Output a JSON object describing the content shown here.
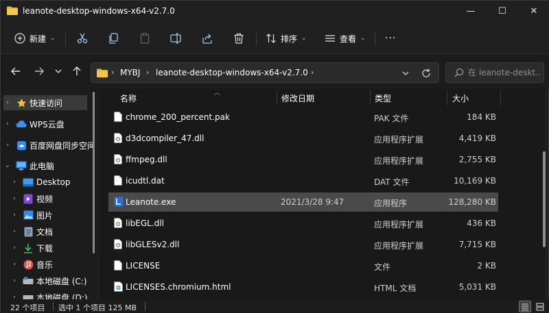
{
  "window": {
    "title": "leanote-desktop-windows-x64-v2.7.0",
    "controls": {
      "minimize": "—",
      "maximize": "☐",
      "close": "✕"
    }
  },
  "toolbar": {
    "new_label": "新建",
    "sort_label": "排序",
    "view_label": "查看",
    "more_label": "···"
  },
  "address": {
    "crumbs": [
      "MYBJ",
      "leanote-desktop-windows-x64-v2.7.0"
    ],
    "search_placeholder": "在 leanote-deskt..."
  },
  "sidebar": {
    "items": [
      {
        "label": "快速访问",
        "icon": "star-icon",
        "selected": true
      },
      {
        "label": "WPS云盘",
        "icon": "cloud-icon"
      },
      {
        "label": "百度网盘同步空间",
        "icon": "baidu-icon"
      },
      {
        "label": "此电脑",
        "icon": "pc-icon",
        "expanded": true
      },
      {
        "label": "Desktop",
        "icon": "desktop-icon"
      },
      {
        "label": "视频",
        "icon": "video-icon"
      },
      {
        "label": "图片",
        "icon": "picture-icon"
      },
      {
        "label": "文档",
        "icon": "document-icon"
      },
      {
        "label": "下载",
        "icon": "download-icon"
      },
      {
        "label": "音乐",
        "icon": "music-icon"
      },
      {
        "label": "本地磁盘 (C:)",
        "icon": "drive-icon"
      },
      {
        "label": "本地磁盘 (D:)",
        "icon": "drive-icon"
      }
    ]
  },
  "columns": {
    "name": "名称",
    "date": "修改日期",
    "type": "类型",
    "size": "大小"
  },
  "files": [
    {
      "name": "chrome_200_percent.pak",
      "date": "",
      "type": "PAK 文件",
      "size": "184 KB",
      "icon": "file-icon"
    },
    {
      "name": "d3dcompiler_47.dll",
      "date": "",
      "type": "应用程序扩展",
      "size": "4,419 KB",
      "icon": "dll-icon"
    },
    {
      "name": "ffmpeg.dll",
      "date": "",
      "type": "应用程序扩展",
      "size": "2,755 KB",
      "icon": "dll-icon"
    },
    {
      "name": "icudtl.dat",
      "date": "",
      "type": "DAT 文件",
      "size": "10,169 KB",
      "icon": "file-icon"
    },
    {
      "name": "Leanote.exe",
      "date": "2021/3/28 9:47",
      "type": "应用程序",
      "size": "128,280 KB",
      "icon": "exe-icon",
      "selected": true
    },
    {
      "name": "libEGL.dll",
      "date": "",
      "type": "应用程序扩展",
      "size": "436 KB",
      "icon": "dll-icon"
    },
    {
      "name": "libGLESv2.dll",
      "date": "",
      "type": "应用程序扩展",
      "size": "7,715 KB",
      "icon": "dll-icon"
    },
    {
      "name": "LICENSE",
      "date": "",
      "type": "文件",
      "size": "2 KB",
      "icon": "file-icon"
    },
    {
      "name": "LICENSES.chromium.html",
      "date": "",
      "type": "HTML 文档",
      "size": "5,031 KB",
      "icon": "html-icon"
    }
  ],
  "status": {
    "count": "22 个项目",
    "selection": "选中 1 个项目  125 MB"
  }
}
